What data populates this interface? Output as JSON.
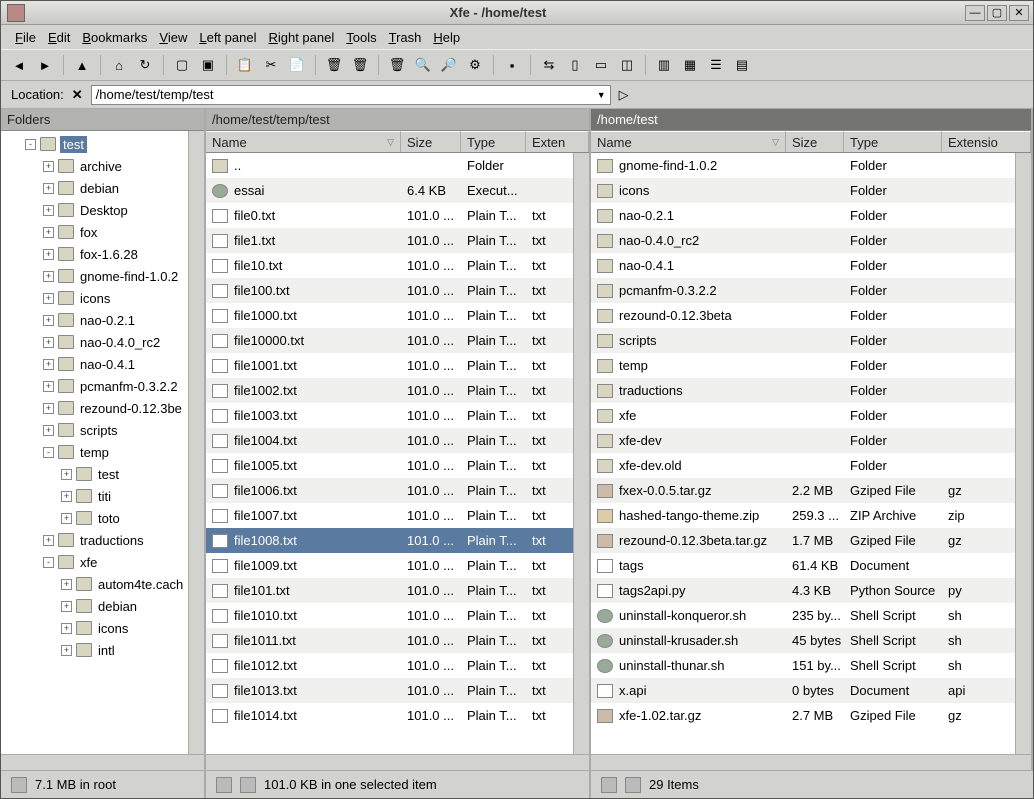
{
  "window": {
    "title": "Xfe - /home/test"
  },
  "menu": [
    "File",
    "Edit",
    "Bookmarks",
    "View",
    "Left panel",
    "Right panel",
    "Tools",
    "Trash",
    "Help"
  ],
  "location": {
    "label": "Location:",
    "path": "/home/test/temp/test"
  },
  "folders": {
    "header": "Folders",
    "tree": [
      {
        "indent": 1,
        "exp": "-",
        "label": "test",
        "selected": true
      },
      {
        "indent": 2,
        "exp": "+",
        "label": "archive"
      },
      {
        "indent": 2,
        "exp": "+",
        "label": "debian"
      },
      {
        "indent": 2,
        "exp": "+",
        "label": "Desktop"
      },
      {
        "indent": 2,
        "exp": "+",
        "label": "fox"
      },
      {
        "indent": 2,
        "exp": "+",
        "label": "fox-1.6.28"
      },
      {
        "indent": 2,
        "exp": "+",
        "label": "gnome-find-1.0.2"
      },
      {
        "indent": 2,
        "exp": "+",
        "label": "icons"
      },
      {
        "indent": 2,
        "exp": "+",
        "label": "nao-0.2.1"
      },
      {
        "indent": 2,
        "exp": "+",
        "label": "nao-0.4.0_rc2"
      },
      {
        "indent": 2,
        "exp": "+",
        "label": "nao-0.4.1"
      },
      {
        "indent": 2,
        "exp": "+",
        "label": "pcmanfm-0.3.2.2"
      },
      {
        "indent": 2,
        "exp": "+",
        "label": "rezound-0.12.3be"
      },
      {
        "indent": 2,
        "exp": "+",
        "label": "scripts"
      },
      {
        "indent": 2,
        "exp": "-",
        "label": "temp"
      },
      {
        "indent": 3,
        "exp": "+",
        "label": "test"
      },
      {
        "indent": 3,
        "exp": "+",
        "label": "titi"
      },
      {
        "indent": 3,
        "exp": "+",
        "label": "toto"
      },
      {
        "indent": 2,
        "exp": "+",
        "label": "traductions"
      },
      {
        "indent": 2,
        "exp": "-",
        "label": "xfe"
      },
      {
        "indent": 3,
        "exp": "+",
        "label": "autom4te.cach"
      },
      {
        "indent": 3,
        "exp": "+",
        "label": "debian"
      },
      {
        "indent": 3,
        "exp": "+",
        "label": "icons"
      },
      {
        "indent": 3,
        "exp": "+",
        "label": "intl"
      }
    ]
  },
  "left": {
    "path": "/home/test/temp/test",
    "cols": {
      "name": "Name",
      "size": "Size",
      "type": "Type",
      "ext": "Exten"
    },
    "rows": [
      {
        "icon": "folder",
        "name": "..",
        "size": "",
        "type": "Folder",
        "ext": ""
      },
      {
        "icon": "exec",
        "name": "essai",
        "size": "6.4 KB",
        "type": "Execut...",
        "ext": ""
      },
      {
        "icon": "txt",
        "name": "file0.txt",
        "size": "101.0 ...",
        "type": "Plain T...",
        "ext": "txt"
      },
      {
        "icon": "txt",
        "name": "file1.txt",
        "size": "101.0 ...",
        "type": "Plain T...",
        "ext": "txt"
      },
      {
        "icon": "txt",
        "name": "file10.txt",
        "size": "101.0 ...",
        "type": "Plain T...",
        "ext": "txt"
      },
      {
        "icon": "txt",
        "name": "file100.txt",
        "size": "101.0 ...",
        "type": "Plain T...",
        "ext": "txt"
      },
      {
        "icon": "txt",
        "name": "file1000.txt",
        "size": "101.0 ...",
        "type": "Plain T...",
        "ext": "txt"
      },
      {
        "icon": "txt",
        "name": "file10000.txt",
        "size": "101.0 ...",
        "type": "Plain T...",
        "ext": "txt"
      },
      {
        "icon": "txt",
        "name": "file1001.txt",
        "size": "101.0 ...",
        "type": "Plain T...",
        "ext": "txt"
      },
      {
        "icon": "txt",
        "name": "file1002.txt",
        "size": "101.0 ...",
        "type": "Plain T...",
        "ext": "txt"
      },
      {
        "icon": "txt",
        "name": "file1003.txt",
        "size": "101.0 ...",
        "type": "Plain T...",
        "ext": "txt"
      },
      {
        "icon": "txt",
        "name": "file1004.txt",
        "size": "101.0 ...",
        "type": "Plain T...",
        "ext": "txt"
      },
      {
        "icon": "txt",
        "name": "file1005.txt",
        "size": "101.0 ...",
        "type": "Plain T...",
        "ext": "txt"
      },
      {
        "icon": "txt",
        "name": "file1006.txt",
        "size": "101.0 ...",
        "type": "Plain T...",
        "ext": "txt"
      },
      {
        "icon": "txt",
        "name": "file1007.txt",
        "size": "101.0 ...",
        "type": "Plain T...",
        "ext": "txt"
      },
      {
        "icon": "txt",
        "name": "file1008.txt",
        "size": "101.0 ...",
        "type": "Plain T...",
        "ext": "txt",
        "selected": true
      },
      {
        "icon": "txt",
        "name": "file1009.txt",
        "size": "101.0 ...",
        "type": "Plain T...",
        "ext": "txt"
      },
      {
        "icon": "txt",
        "name": "file101.txt",
        "size": "101.0 ...",
        "type": "Plain T...",
        "ext": "txt"
      },
      {
        "icon": "txt",
        "name": "file1010.txt",
        "size": "101.0 ...",
        "type": "Plain T...",
        "ext": "txt"
      },
      {
        "icon": "txt",
        "name": "file1011.txt",
        "size": "101.0 ...",
        "type": "Plain T...",
        "ext": "txt"
      },
      {
        "icon": "txt",
        "name": "file1012.txt",
        "size": "101.0 ...",
        "type": "Plain T...",
        "ext": "txt"
      },
      {
        "icon": "txt",
        "name": "file1013.txt",
        "size": "101.0 ...",
        "type": "Plain T...",
        "ext": "txt"
      },
      {
        "icon": "txt",
        "name": "file1014.txt",
        "size": "101.0 ...",
        "type": "Plain T...",
        "ext": "txt"
      }
    ]
  },
  "right": {
    "path": "/home/test",
    "cols": {
      "name": "Name",
      "size": "Size",
      "type": "Type",
      "ext": "Extensio"
    },
    "rows": [
      {
        "icon": "folder",
        "name": "gnome-find-1.0.2",
        "size": "",
        "type": "Folder",
        "ext": ""
      },
      {
        "icon": "folder",
        "name": "icons",
        "size": "",
        "type": "Folder",
        "ext": ""
      },
      {
        "icon": "folder",
        "name": "nao-0.2.1",
        "size": "",
        "type": "Folder",
        "ext": ""
      },
      {
        "icon": "folder",
        "name": "nao-0.4.0_rc2",
        "size": "",
        "type": "Folder",
        "ext": ""
      },
      {
        "icon": "folder",
        "name": "nao-0.4.1",
        "size": "",
        "type": "Folder",
        "ext": ""
      },
      {
        "icon": "folder",
        "name": "pcmanfm-0.3.2.2",
        "size": "",
        "type": "Folder",
        "ext": ""
      },
      {
        "icon": "folder",
        "name": "rezound-0.12.3beta",
        "size": "",
        "type": "Folder",
        "ext": ""
      },
      {
        "icon": "folder",
        "name": "scripts",
        "size": "",
        "type": "Folder",
        "ext": ""
      },
      {
        "icon": "folder",
        "name": "temp",
        "size": "",
        "type": "Folder",
        "ext": ""
      },
      {
        "icon": "folder",
        "name": "traductions",
        "size": "",
        "type": "Folder",
        "ext": ""
      },
      {
        "icon": "folder",
        "name": "xfe",
        "size": "",
        "type": "Folder",
        "ext": ""
      },
      {
        "icon": "folder",
        "name": "xfe-dev",
        "size": "",
        "type": "Folder",
        "ext": ""
      },
      {
        "icon": "folder",
        "name": "xfe-dev.old",
        "size": "",
        "type": "Folder",
        "ext": ""
      },
      {
        "icon": "gz",
        "name": "fxex-0.0.5.tar.gz",
        "size": "2.2 MB",
        "type": "Gziped File",
        "ext": "gz"
      },
      {
        "icon": "zip",
        "name": "hashed-tango-theme.zip",
        "size": "259.3 ...",
        "type": "ZIP Archive",
        "ext": "zip"
      },
      {
        "icon": "gz",
        "name": "rezound-0.12.3beta.tar.gz",
        "size": "1.7 MB",
        "type": "Gziped File",
        "ext": "gz"
      },
      {
        "icon": "txt",
        "name": "tags",
        "size": "61.4 KB",
        "type": "Document",
        "ext": ""
      },
      {
        "icon": "txt",
        "name": "tags2api.py",
        "size": "4.3 KB",
        "type": "Python Source",
        "ext": "py"
      },
      {
        "icon": "exec",
        "name": "uninstall-konqueror.sh",
        "size": "235 by...",
        "type": "Shell Script",
        "ext": "sh"
      },
      {
        "icon": "exec",
        "name": "uninstall-krusader.sh",
        "size": "45 bytes",
        "type": "Shell Script",
        "ext": "sh"
      },
      {
        "icon": "exec",
        "name": "uninstall-thunar.sh",
        "size": "151 by...",
        "type": "Shell Script",
        "ext": "sh"
      },
      {
        "icon": "txt",
        "name": "x.api",
        "size": "0 bytes",
        "type": "Document",
        "ext": "api"
      },
      {
        "icon": "gz",
        "name": "xfe-1.02.tar.gz",
        "size": "2.7 MB",
        "type": "Gziped File",
        "ext": "gz"
      }
    ]
  },
  "status": {
    "folders": "7.1 MB in root",
    "left": "101.0 KB in one selected item",
    "right": "29 Items"
  },
  "toolbar_icons": [
    "back",
    "forward",
    "up",
    "home",
    "refresh",
    "new-file",
    "new-folder",
    "copy",
    "cut",
    "paste",
    "delete",
    "trash-empty",
    "trash-full",
    "find",
    "replace",
    "gear",
    "terminal",
    "sync",
    "panel-tree",
    "panel-one",
    "panel-two",
    "panel-tree2",
    "view-icons",
    "view-list",
    "view-details"
  ]
}
